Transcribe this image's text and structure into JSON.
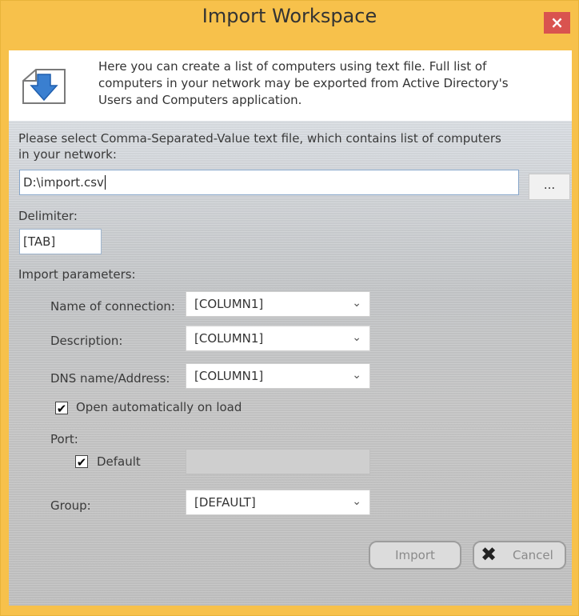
{
  "window": {
    "title": "Import Workspace",
    "close_glyph": "×"
  },
  "info": {
    "icon": "download-arrow-icon",
    "line1": "Here you can create a list of computers using text file. Full list of",
    "line2": "computers in your network may be exported from  Active Directory's",
    "line3": "Users and Computers application."
  },
  "file_select": {
    "label_line1": "Please select Comma-Separated-Value  text file,  which contains list of computers",
    "label_line2": "in your network:",
    "value": "D:\\import.csv",
    "browse_label": "..."
  },
  "delimiter": {
    "label": "Delimiter:",
    "value": "[TAB]"
  },
  "import_params": {
    "label": "Import parameters:",
    "name_label": "Name of connection:",
    "name_value": "[COLUMN1]",
    "description_label": "Description:",
    "description_value": "[COLUMN1]",
    "dns_label": "DNS name/Address:",
    "dns_value": "[COLUMN1]",
    "open_auto_label": "Open automatically on load",
    "open_auto_checked": true,
    "port_label": "Port:",
    "port_default_label": "Default",
    "port_default_checked": true,
    "port_value": "",
    "group_label": "Group:",
    "group_value": "[DEFAULT]"
  },
  "buttons": {
    "import_label": "Import",
    "cancel_label": "Cancel"
  },
  "glyphs": {
    "check": "✔",
    "chevron": "⌄",
    "cancel_x": "✖"
  },
  "colors": {
    "titlebar": "#f7c14b",
    "close_button": "#d9534f",
    "icon_blue": "#3a7fd0"
  }
}
